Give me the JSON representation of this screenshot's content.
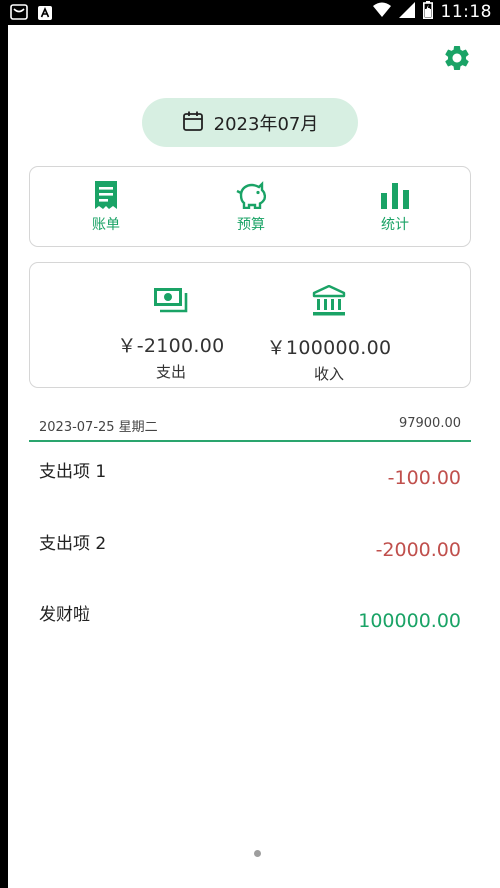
{
  "status_bar": {
    "time": "11:18",
    "icons": [
      "notification-icon",
      "a-badge-icon",
      "wifi-icon",
      "signal-icon",
      "battery-icon"
    ]
  },
  "header": {
    "settings_icon": "gear-icon",
    "month_label": "2023年07月",
    "calendar_icon": "calendar-icon"
  },
  "nav": {
    "items": [
      {
        "label": "账单",
        "icon": "receipt-icon"
      },
      {
        "label": "预算",
        "icon": "piggy-bank-icon"
      },
      {
        "label": "统计",
        "icon": "bar-chart-icon"
      }
    ]
  },
  "summary": {
    "expense": {
      "amount": "￥-2100.00",
      "caption": "支出",
      "icon": "cash-icon"
    },
    "income": {
      "amount": "￥100000.00",
      "caption": "收入",
      "icon": "bank-icon"
    }
  },
  "day_group": {
    "date": "2023-07-25 星期二",
    "total": "97900.00"
  },
  "entries": [
    {
      "name": "支出项 1",
      "amount": "-100.00",
      "kind": "expense"
    },
    {
      "name": "支出项 2",
      "amount": "-2000.00",
      "kind": "expense"
    },
    {
      "name": "发财啦",
      "amount": "100000.00",
      "kind": "income"
    }
  ],
  "colors": {
    "accent": "#1aa366",
    "expense": "#c0504d",
    "pill_bg": "#d7efe2"
  }
}
